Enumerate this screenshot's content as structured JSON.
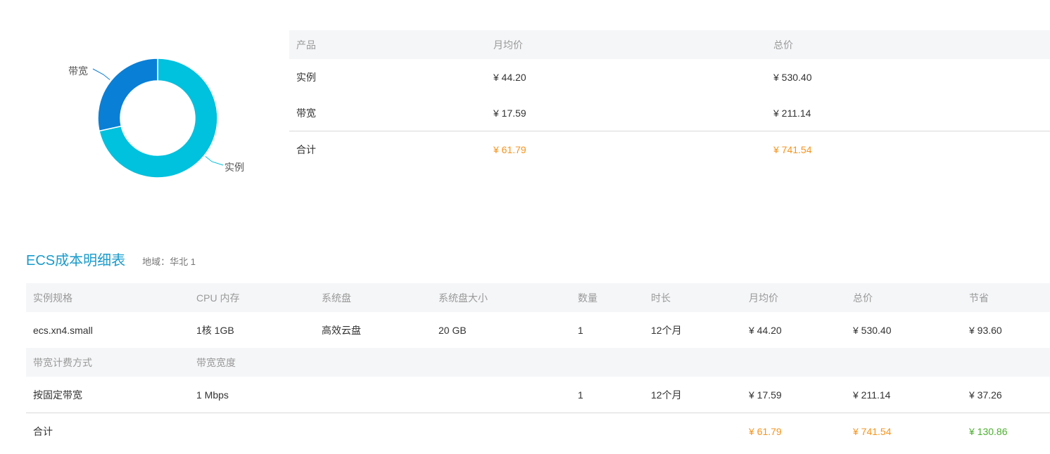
{
  "chart_data": {
    "type": "pie",
    "donut": true,
    "labels": [
      "实例",
      "带宽"
    ],
    "values": [
      530.4,
      211.14
    ],
    "colors": [
      "#00c1de",
      "#0a7fd6"
    ]
  },
  "summary": {
    "headers": [
      "产品",
      "月均价",
      "总价"
    ],
    "rows": [
      [
        "实例",
        "¥ 44.20",
        "¥ 530.40"
      ],
      [
        "带宽",
        "¥ 17.59",
        "¥ 211.14"
      ]
    ],
    "total": [
      "合计",
      "¥ 61.79",
      "¥ 741.54"
    ]
  },
  "detail": {
    "title": "ECS成本明细表",
    "region": "地域：华北 1",
    "instance_headers": [
      "实例规格",
      "CPU 内存",
      "系统盘",
      "系统盘大小",
      "数量",
      "时长",
      "月均价",
      "总价",
      "节省"
    ],
    "instance_row": [
      "ecs.xn4.small",
      "1核 1GB",
      "高效云盘",
      "20 GB",
      "1",
      "12个月",
      "¥ 44.20",
      "¥ 530.40",
      "¥ 93.60"
    ],
    "bandwidth_headers": [
      "带宽计费方式",
      "带宽宽度"
    ],
    "bandwidth_row": [
      "按固定带宽",
      "1 Mbps",
      "",
      "",
      "1",
      "12个月",
      "¥ 17.59",
      "¥ 211.14",
      "¥ 37.26"
    ],
    "total": [
      "合计",
      "¥ 61.79",
      "¥ 741.54",
      "¥ 130.86"
    ]
  },
  "colors": {
    "accent_title": "#1a9bcb",
    "price_total": "#f7941d",
    "savings_total": "#4caf2f",
    "header_bg": "#f5f6f8"
  }
}
